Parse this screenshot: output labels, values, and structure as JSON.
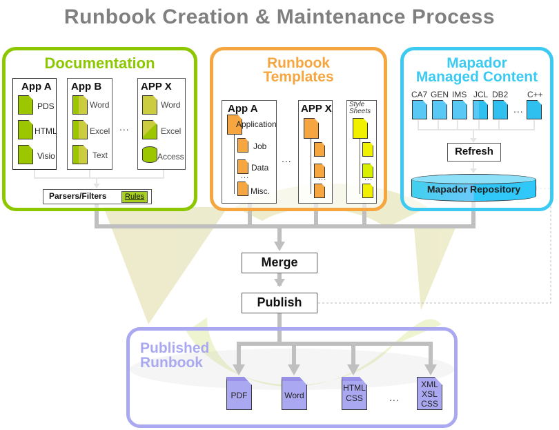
{
  "title": "Runbook Creation & Maintenance Process",
  "colors": {
    "documentation": "#8cc700",
    "templates": "#f5a640",
    "managed": "#3ccaf2",
    "published": "#aaa8f0",
    "connector": "#c0c0c0",
    "watermark": "#e6e6c0"
  },
  "documentation": {
    "title": "Documentation",
    "apps": [
      {
        "name": "App A",
        "items": [
          "PDS",
          "HTML",
          "Visio"
        ]
      },
      {
        "name": "App B",
        "items": [
          "Word",
          "Excel",
          "Text"
        ]
      },
      {
        "name": "APP X",
        "items": [
          "Word",
          "Excel",
          "Access"
        ]
      }
    ],
    "ellipsis": "...",
    "parsers_label": "Parsers/Filters",
    "rules_label": "Rules"
  },
  "templates": {
    "title_line1": "Runbook",
    "title_line2": "Templates",
    "app_a": {
      "name": "App A",
      "root": "Application",
      "items": [
        "Job",
        "Data",
        "Misc."
      ]
    },
    "app_x": {
      "name": "APP X"
    },
    "style_sheets": "Style Sheets",
    "ellipsis": "..."
  },
  "managed": {
    "title_line1": "Mapador",
    "title_line2": "Managed Content",
    "items": [
      "CA7",
      "GEN",
      "IMS",
      "JCL",
      "DB2",
      "C++"
    ],
    "ellipsis": "...",
    "refresh_label": "Refresh",
    "repository_label": "Mapador Repository"
  },
  "flow": {
    "merge_label": "Merge",
    "publish_label": "Publish"
  },
  "published": {
    "title_line1": "Published",
    "title_line2": "Runbook",
    "outputs": [
      "PDF",
      "Word",
      "HTML CSS",
      "XML XSL CSS"
    ],
    "ellipsis": "..."
  }
}
